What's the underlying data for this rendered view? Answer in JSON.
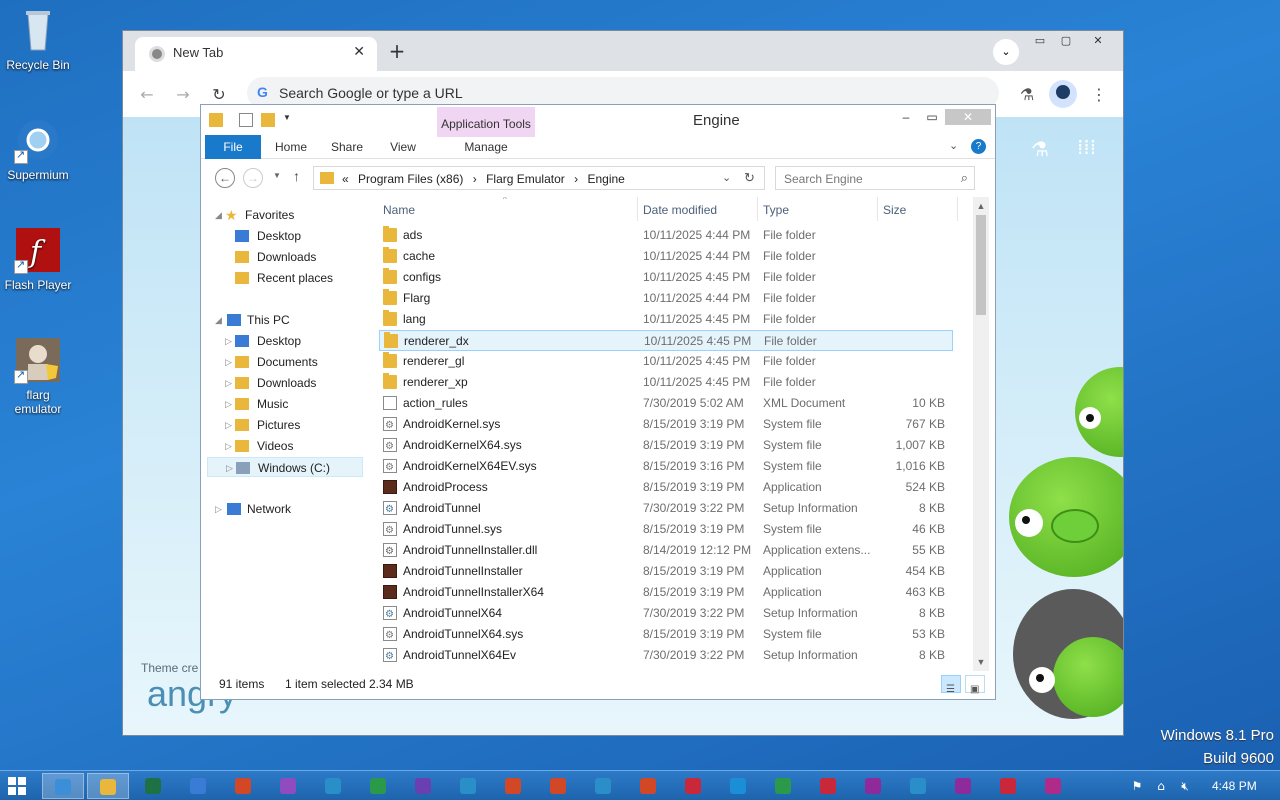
{
  "desktop": {
    "icons": [
      {
        "label": "Recycle Bin"
      },
      {
        "label": "Supermium"
      },
      {
        "label": "Flash Player"
      },
      {
        "label": "flarg emulator"
      }
    ],
    "watermark_line1": "Windows 8.1 Pro",
    "watermark_line2": "Build 9600"
  },
  "browser": {
    "tab_title": "New Tab",
    "tab_close": "✕",
    "new_tab": "+",
    "omnibox_placeholder": "Search Google or type a URL",
    "omnibox_icon": "G",
    "theme_label": "Theme cre",
    "theme_title": "angry"
  },
  "explorer": {
    "contextual_tab": "Application Tools",
    "caption": "Engine",
    "ribbon_tabs": [
      "File",
      "Home",
      "Share",
      "View",
      "Manage"
    ],
    "breadcrumb": [
      "«",
      "Program Files (x86)",
      "›",
      "Flarg Emulator",
      "›",
      "Engine"
    ],
    "search_placeholder": "Search Engine",
    "nav": {
      "favorites": "Favorites",
      "favorites_items": [
        "Desktop",
        "Downloads",
        "Recent places"
      ],
      "this_pc": "This PC",
      "this_pc_items": [
        "Desktop",
        "Documents",
        "Downloads",
        "Music",
        "Pictures",
        "Videos",
        "Windows (C:)"
      ],
      "network": "Network"
    },
    "columns": {
      "name": "Name",
      "date": "Date modified",
      "type": "Type",
      "size": "Size"
    },
    "files": [
      {
        "name": "ads",
        "date": "10/11/2025 4:44 PM",
        "type": "File folder",
        "size": "",
        "icon": "folder"
      },
      {
        "name": "cache",
        "date": "10/11/2025 4:44 PM",
        "type": "File folder",
        "size": "",
        "icon": "folder"
      },
      {
        "name": "configs",
        "date": "10/11/2025 4:45 PM",
        "type": "File folder",
        "size": "",
        "icon": "folder"
      },
      {
        "name": "Flarg",
        "date": "10/11/2025 4:44 PM",
        "type": "File folder",
        "size": "",
        "icon": "folder"
      },
      {
        "name": "lang",
        "date": "10/11/2025 4:45 PM",
        "type": "File folder",
        "size": "",
        "icon": "folder"
      },
      {
        "name": "renderer_dx",
        "date": "10/11/2025 4:45 PM",
        "type": "File folder",
        "size": "",
        "icon": "folder",
        "selected": true
      },
      {
        "name": "renderer_gl",
        "date": "10/11/2025 4:45 PM",
        "type": "File folder",
        "size": "",
        "icon": "folder"
      },
      {
        "name": "renderer_xp",
        "date": "10/11/2025 4:45 PM",
        "type": "File folder",
        "size": "",
        "icon": "folder"
      },
      {
        "name": "action_rules",
        "date": "7/30/2019 5:02 AM",
        "type": "XML Document",
        "size": "10 KB",
        "icon": "doc"
      },
      {
        "name": "AndroidKernel.sys",
        "date": "8/15/2019 3:19 PM",
        "type": "System file",
        "size": "767 KB",
        "icon": "sys"
      },
      {
        "name": "AndroidKernelX64.sys",
        "date": "8/15/2019 3:19 PM",
        "type": "System file",
        "size": "1,007 KB",
        "icon": "sys"
      },
      {
        "name": "AndroidKernelX64EV.sys",
        "date": "8/15/2019 3:16 PM",
        "type": "System file",
        "size": "1,016 KB",
        "icon": "sys"
      },
      {
        "name": "AndroidProcess",
        "date": "8/15/2019 3:19 PM",
        "type": "Application",
        "size": "524 KB",
        "icon": "app"
      },
      {
        "name": "AndroidTunnel",
        "date": "7/30/2019 3:22 PM",
        "type": "Setup Information",
        "size": "8 KB",
        "icon": "setup"
      },
      {
        "name": "AndroidTunnel.sys",
        "date": "8/15/2019 3:19 PM",
        "type": "System file",
        "size": "46 KB",
        "icon": "sys"
      },
      {
        "name": "AndroidTunnelInstaller.dll",
        "date": "8/14/2019 12:12 PM",
        "type": "Application extens...",
        "size": "55 KB",
        "icon": "dll"
      },
      {
        "name": "AndroidTunnelInstaller",
        "date": "8/15/2019 3:19 PM",
        "type": "Application",
        "size": "454 KB",
        "icon": "app"
      },
      {
        "name": "AndroidTunnelInstallerX64",
        "date": "8/15/2019 3:19 PM",
        "type": "Application",
        "size": "463 KB",
        "icon": "app"
      },
      {
        "name": "AndroidTunnelX64",
        "date": "7/30/2019 3:22 PM",
        "type": "Setup Information",
        "size": "8 KB",
        "icon": "setup"
      },
      {
        "name": "AndroidTunnelX64.sys",
        "date": "8/15/2019 3:19 PM",
        "type": "System file",
        "size": "53 KB",
        "icon": "sys"
      },
      {
        "name": "AndroidTunnelX64Ev",
        "date": "7/30/2019 3:22 PM",
        "type": "Setup Information",
        "size": "8 KB",
        "icon": "setup"
      }
    ],
    "status": {
      "items": "91 items",
      "selected": "1 item selected",
      "size": "2.34 MB"
    }
  },
  "taskbar": {
    "clock": "4:48 PM",
    "buttons": [
      {
        "name": "supermium",
        "color": "#3a8fd8"
      },
      {
        "name": "file-explorer",
        "color": "#e8b73b"
      },
      {
        "name": "excel",
        "color": "#1e7145"
      },
      {
        "name": "mail",
        "color": "#3a7bd5"
      },
      {
        "name": "photos-app",
        "color": "#d24726"
      },
      {
        "name": "onenote-style",
        "color": "#8f4bc0"
      },
      {
        "name": "photos",
        "color": "#2a8fc8"
      },
      {
        "name": "finance",
        "color": "#2a9a4a"
      },
      {
        "name": "trophy",
        "color": "#6a3fb0"
      },
      {
        "name": "weather",
        "color": "#2a8fc8"
      },
      {
        "name": "food",
        "color": "#d24726"
      },
      {
        "name": "health",
        "color": "#d24726"
      },
      {
        "name": "reader",
        "color": "#2a8fc8"
      },
      {
        "name": "help",
        "color": "#d24726"
      },
      {
        "name": "news",
        "color": "#c8283a"
      },
      {
        "name": "skype",
        "color": "#1a8fd8"
      },
      {
        "name": "games",
        "color": "#2a9a4a"
      },
      {
        "name": "video",
        "color": "#c8283a"
      },
      {
        "name": "onenote",
        "color": "#8f2a9a"
      },
      {
        "name": "settings-app",
        "color": "#2a8fc8"
      },
      {
        "name": "calendar",
        "color": "#8f2a9a"
      },
      {
        "name": "store",
        "color": "#c8283a"
      },
      {
        "name": "music",
        "color": "#b02a8a"
      }
    ]
  }
}
